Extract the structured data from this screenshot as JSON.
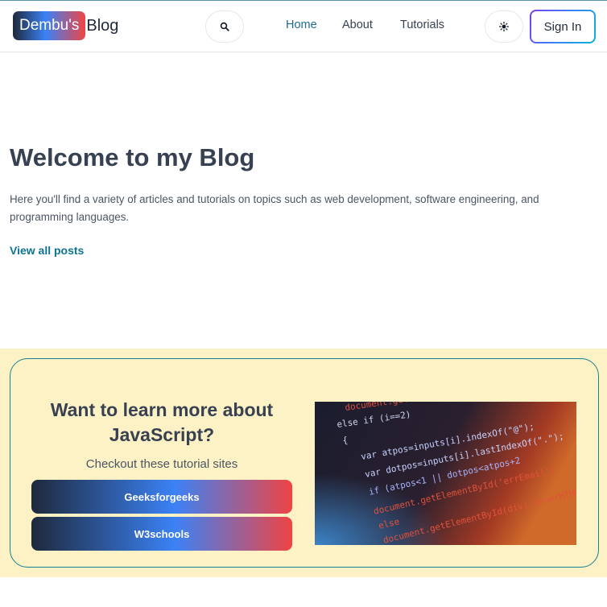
{
  "header": {
    "logo_badge": "Dembu's",
    "logo_text": "Blog",
    "nav": [
      {
        "label": "Home",
        "active": true
      },
      {
        "label": "About",
        "active": false
      },
      {
        "label": "Tutorials",
        "active": false
      }
    ],
    "signin_label": "Sign In",
    "search_icon": "search-icon",
    "theme_icon": "sun-icon"
  },
  "hero": {
    "title": "Welcome to my Blog",
    "description": "Here you'll find a variety of articles and tutorials on topics such as web development, software engineering, and programming languages.",
    "link_label": "View all posts"
  },
  "promo": {
    "heading": "Want to learn more about JavaScript?",
    "subheading": "Checkout these tutorial sites",
    "buttons": [
      {
        "label": "Geeksforgeeks"
      },
      {
        "label": "W3schools"
      }
    ],
    "image_code_lines": [
      "document.getElementById(div).innerHTML",
      "else if (i==2)",
      "{",
      "var atpos=inputs[i].indexOf(\"@\");",
      "var dotpos=inputs[i].lastIndexOf(\".\");",
      "if (atpos<1 || dotpos<atpos+2",
      "document.getElementById('errEmail')",
      "else",
      "document.getElementById(div).innerHTML"
    ]
  },
  "colors": {
    "accent": "#0e7490",
    "promo_bg": "#fdf1c6",
    "card_border": "#14818f"
  }
}
